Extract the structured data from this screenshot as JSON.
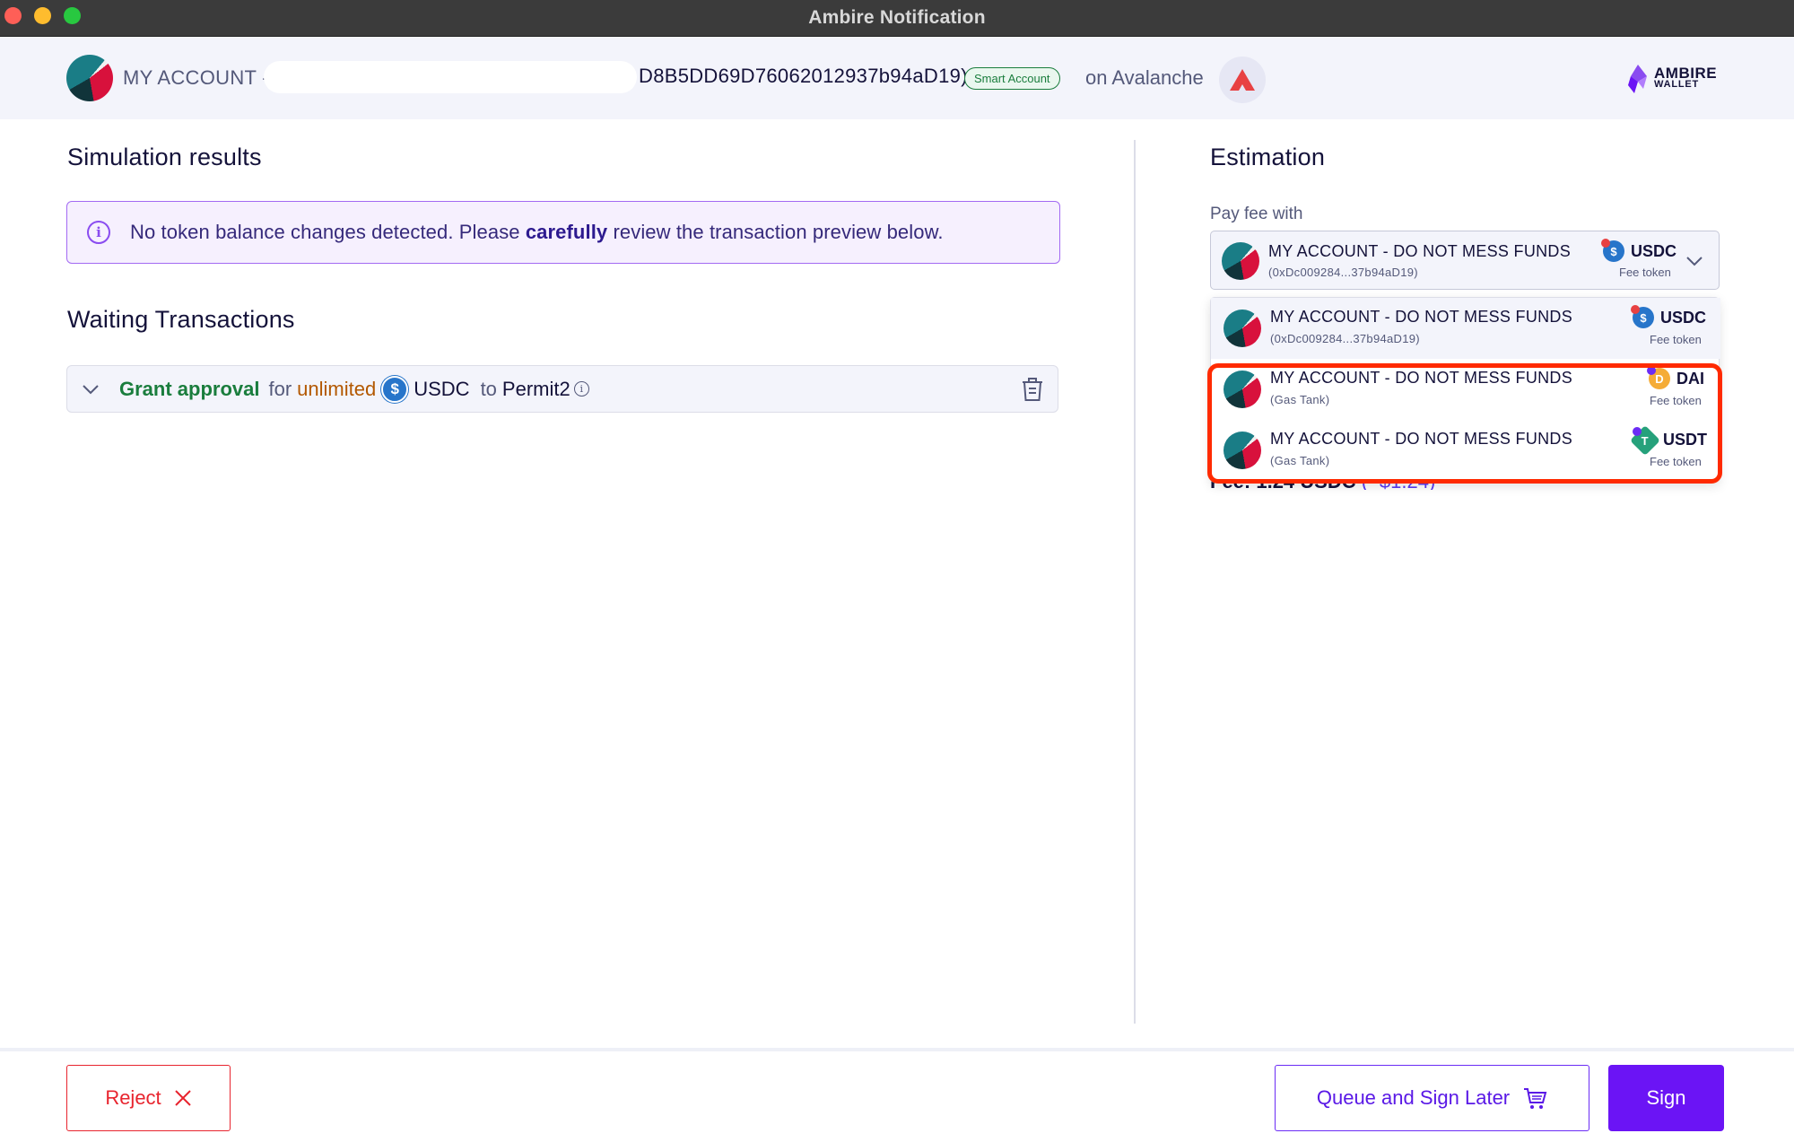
{
  "window": {
    "title": "Ambire Notification"
  },
  "header": {
    "account_label": "MY ACCOUNT -",
    "account_address_tail": "D8B5DD69D76062012937b94aD19)",
    "account_type_badge": "Smart Account",
    "network_text": "on Avalanche",
    "network_icon": "avalanche-icon",
    "brand_line1": "AMBIRE",
    "brand_line2": "WALLET"
  },
  "simulation": {
    "title": "Simulation results",
    "info_prefix": "No token balance changes detected. Please ",
    "info_emphasis": "carefully",
    "info_suffix": " review the transaction preview below."
  },
  "waiting": {
    "title": "Waiting Transactions",
    "transactions": [
      {
        "action": "Grant approval",
        "for_text": "for",
        "amount": "unlimited",
        "token": "USDC",
        "to_text": "to",
        "destination": "Permit2"
      }
    ]
  },
  "estimation": {
    "title": "Estimation",
    "pay_fee_label": "Pay fee with",
    "selected": {
      "name": "MY ACCOUNT - DO NOT MESS FUNDS",
      "sub": "(0xDc009284...37b94aD19)",
      "token": "USDC",
      "fee_label": "Fee token"
    },
    "options": [
      {
        "name": "MY ACCOUNT - DO NOT MESS FUNDS",
        "sub": "(0xDc009284...37b94aD19)",
        "token": "USDC",
        "fee_label": "Fee token"
      },
      {
        "name": "MY ACCOUNT - DO NOT MESS FUNDS",
        "sub": "(Gas Tank)",
        "token": "DAI",
        "fee_label": "Fee token"
      },
      {
        "name": "MY ACCOUNT - DO NOT MESS FUNDS",
        "sub": "(Gas Tank)",
        "token": "USDT",
        "fee_label": "Fee token"
      }
    ],
    "fee_peek": "Fee: 1.24 USDC",
    "fee_peek_usd": "(~$1.24)"
  },
  "footer": {
    "reject_label": "Reject",
    "queue_label": "Queue and Sign Later",
    "sign_label": "Sign"
  },
  "colors": {
    "accent": "#6b14f5",
    "danger": "#e8242e",
    "success": "#1a7d3d",
    "highlight": "#ff2a00"
  }
}
